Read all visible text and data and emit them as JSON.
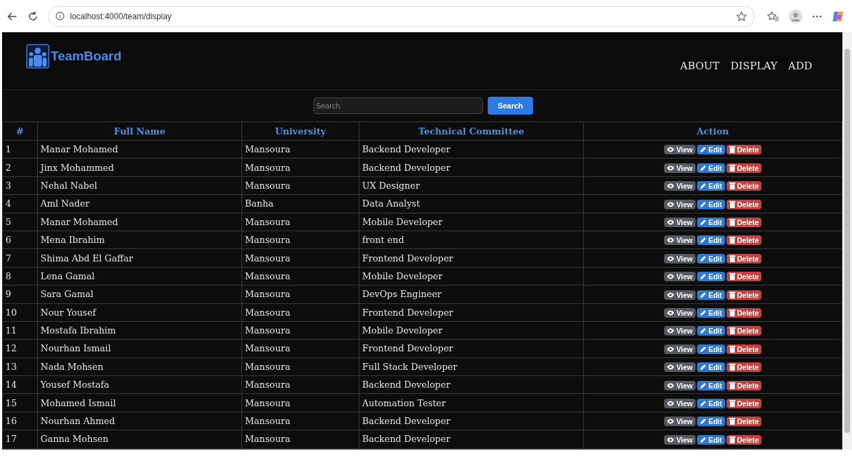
{
  "browser": {
    "url": "localhost:4000/team/display"
  },
  "header": {
    "logo": "TeamBoard",
    "nav": [
      "ABOUT",
      "DISPLAY",
      "ADD"
    ]
  },
  "search": {
    "placeholder": "Search",
    "button": "Search"
  },
  "table": {
    "columns": [
      "#",
      "Full Name",
      "University",
      "Technical Committee",
      "Action"
    ],
    "rows": [
      {
        "cells": [
          "1",
          "Manar Mohamed",
          "Mansoura",
          "Backend Developer"
        ],
        "actions": [
          {
            "kind": "view",
            "label": "View"
          },
          {
            "kind": "edit",
            "label": "Edit"
          },
          {
            "kind": "delete",
            "label": "Delete"
          }
        ]
      },
      {
        "cells": [
          "2",
          "Jinx Mohammed",
          "Mansoura",
          "Backend Developer"
        ],
        "actions": [
          {
            "kind": "view",
            "label": "View"
          },
          {
            "kind": "edit",
            "label": "Edit"
          },
          {
            "kind": "delete",
            "label": "Delete"
          }
        ]
      },
      {
        "cells": [
          "3",
          "Nehal Nabel",
          "Mansoura",
          "UX Designer"
        ],
        "actions": [
          {
            "kind": "view",
            "label": "View"
          },
          {
            "kind": "edit",
            "label": "Edit"
          },
          {
            "kind": "delete",
            "label": "Delete"
          }
        ]
      },
      {
        "cells": [
          "4",
          "Aml Nader",
          "Banha",
          "Data Analyst"
        ],
        "actions": [
          {
            "kind": "view",
            "label": "View"
          },
          {
            "kind": "edit",
            "label": "Edit"
          },
          {
            "kind": "delete",
            "label": "Delete"
          }
        ]
      },
      {
        "cells": [
          "5",
          "Manar Mohamed",
          "Mansoura",
          "Mobile Developer"
        ],
        "actions": [
          {
            "kind": "view",
            "label": "View"
          },
          {
            "kind": "edit",
            "label": "Edit"
          },
          {
            "kind": "delete",
            "label": "Delete"
          }
        ]
      },
      {
        "cells": [
          "6",
          "Mena Ibrahim",
          "Mansoura",
          "front end"
        ],
        "actions": [
          {
            "kind": "view",
            "label": "View"
          },
          {
            "kind": "edit",
            "label": "Edit"
          },
          {
            "kind": "delete",
            "label": "Delete"
          }
        ]
      },
      {
        "cells": [
          "7",
          "Shima Abd El Gaffar",
          "Mansoura",
          "Frontend Developer"
        ],
        "actions": [
          {
            "kind": "view",
            "label": "View"
          },
          {
            "kind": "edit",
            "label": "Edit"
          },
          {
            "kind": "delete",
            "label": "Delete"
          }
        ]
      },
      {
        "cells": [
          "8",
          "Lena Gamal",
          "Mansoura",
          "Mobile Developer"
        ],
        "actions": [
          {
            "kind": "view",
            "label": "View"
          },
          {
            "kind": "edit",
            "label": "Edit"
          },
          {
            "kind": "delete",
            "label": "Delete"
          }
        ]
      },
      {
        "cells": [
          "9",
          "Sara Gamal",
          "Mansoura",
          "DevOps Engineer"
        ],
        "actions": [
          {
            "kind": "view",
            "label": "View"
          },
          {
            "kind": "edit",
            "label": "Edit"
          },
          {
            "kind": "delete",
            "label": "Delete"
          }
        ]
      },
      {
        "cells": [
          "10",
          "Nour Yousef",
          "Mansoura",
          "Frontend Developer"
        ],
        "actions": [
          {
            "kind": "view",
            "label": "View"
          },
          {
            "kind": "edit",
            "label": "Edit"
          },
          {
            "kind": "delete",
            "label": "Delete"
          }
        ]
      },
      {
        "cells": [
          "11",
          "Mostafa Ibrahim",
          "Mansoura",
          "Mobile Developer"
        ],
        "actions": [
          {
            "kind": "view",
            "label": "View"
          },
          {
            "kind": "edit",
            "label": "Edit"
          },
          {
            "kind": "delete",
            "label": "Delete"
          }
        ]
      },
      {
        "cells": [
          "12",
          "Nourhan Ismail",
          "Mansoura",
          "Frontend Developer"
        ],
        "actions": [
          {
            "kind": "view",
            "label": "View"
          },
          {
            "kind": "edit",
            "label": "Edit"
          },
          {
            "kind": "delete",
            "label": "Delete"
          }
        ]
      },
      {
        "cells": [
          "13",
          "Nada Mohsen",
          "Mansoura",
          "Full Stack Developer"
        ],
        "actions": [
          {
            "kind": "view",
            "label": "View"
          },
          {
            "kind": "edit",
            "label": "Edit"
          },
          {
            "kind": "delete",
            "label": "Delete"
          }
        ]
      },
      {
        "cells": [
          "14",
          "Yousef Mostafa",
          "Mansoura",
          "Backend Developer"
        ],
        "actions": [
          {
            "kind": "view",
            "label": "View"
          },
          {
            "kind": "edit",
            "label": "Edit"
          },
          {
            "kind": "delete",
            "label": "Delete"
          }
        ]
      },
      {
        "cells": [
          "15",
          "Mohamed Ismail",
          "Mansoura",
          "Automation Tester"
        ],
        "actions": [
          {
            "kind": "view",
            "label": "View"
          },
          {
            "kind": "edit",
            "label": "Edit"
          },
          {
            "kind": "delete",
            "label": "Delete"
          }
        ]
      },
      {
        "cells": [
          "16",
          "Nourhan Ahmed",
          "Mansoura",
          "Backend Developer"
        ],
        "actions": [
          {
            "kind": "view",
            "label": "View"
          },
          {
            "kind": "edit",
            "label": "Edit"
          },
          {
            "kind": "delete",
            "label": "Delete"
          }
        ]
      },
      {
        "cells": [
          "17",
          "Ganna Mohsen",
          "Mansoura",
          "Backend Developer"
        ],
        "actions": [
          {
            "kind": "view",
            "label": "View"
          },
          {
            "kind": "edit",
            "label": "Edit"
          },
          {
            "kind": "delete",
            "label": "Delete"
          }
        ]
      }
    ]
  }
}
